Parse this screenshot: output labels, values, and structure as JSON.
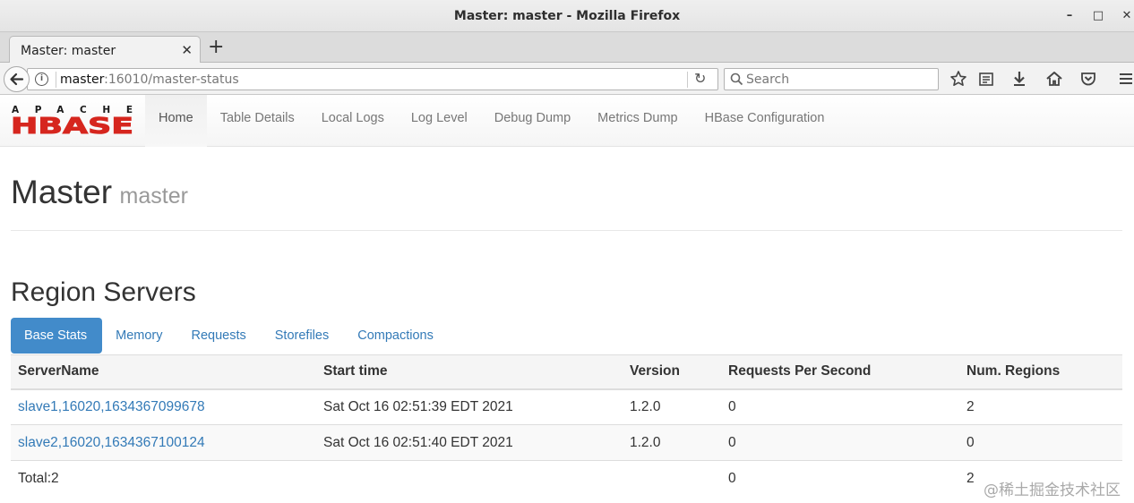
{
  "window": {
    "title": "Master: master - Mozilla Firefox"
  },
  "browser": {
    "tab_title": "Master: master",
    "url_host": "master",
    "url_rest": ":16010/master-status",
    "search_placeholder": "Search"
  },
  "logo": {
    "top_text": "APACHE",
    "main_text": "HBASE",
    "accent_color": "#d6261e"
  },
  "nav": {
    "items": [
      {
        "label": "Home"
      },
      {
        "label": "Table Details"
      },
      {
        "label": "Local Logs"
      },
      {
        "label": "Log Level"
      },
      {
        "label": "Debug Dump"
      },
      {
        "label": "Metrics Dump"
      },
      {
        "label": "HBase Configuration"
      }
    ]
  },
  "header": {
    "title": "Master",
    "subtitle": "master"
  },
  "region_servers": {
    "title": "Region Servers",
    "tabs": [
      {
        "label": "Base Stats"
      },
      {
        "label": "Memory"
      },
      {
        "label": "Requests"
      },
      {
        "label": "Storefiles"
      },
      {
        "label": "Compactions"
      }
    ],
    "columns": [
      "ServerName",
      "Start time",
      "Version",
      "Requests Per Second",
      "Num. Regions"
    ],
    "rows": [
      {
        "server": "slave1,16020,1634367099678",
        "start": "Sat Oct 16 02:51:39 EDT 2021",
        "version": "1.2.0",
        "rps": "0",
        "regions": "2"
      },
      {
        "server": "slave2,16020,1634367100124",
        "start": "Sat Oct 16 02:51:40 EDT 2021",
        "version": "1.2.0",
        "rps": "0",
        "regions": "0"
      }
    ],
    "total": {
      "label": "Total:2",
      "rps": "0",
      "regions": "2"
    }
  },
  "watermark": "@稀土掘金技术社区",
  "colors": {
    "link": "#337ab7",
    "active_tab": "#428bca"
  }
}
